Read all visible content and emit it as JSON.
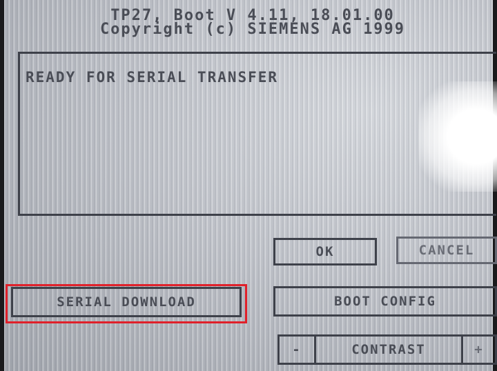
{
  "header": {
    "line1": "TP27, Boot V 4.11, 18.01.00",
    "line2": "Copyright (c) SIEMENS AG 1999"
  },
  "message": {
    "text": "READY FOR SERIAL TRANSFER"
  },
  "buttons": {
    "ok": "OK",
    "cancel": "CANCEL",
    "serial_download": "SERIAL DOWNLOAD",
    "boot_config": "BOOT CONFIG"
  },
  "contrast": {
    "minus": "-",
    "label": "CONTRAST",
    "plus": "+"
  },
  "colors": {
    "highlight": "#e0202a",
    "screen": "#c3c6cc",
    "text": "#4a4d56"
  }
}
